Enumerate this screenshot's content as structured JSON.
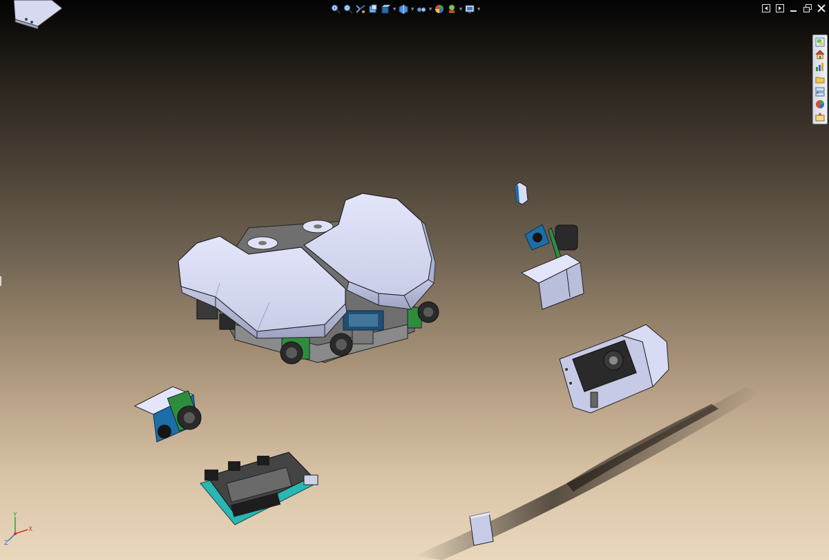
{
  "toolbar": {
    "icons": [
      "zoom-in-icon",
      "zoom-out-icon",
      "fly-icon",
      "view-cube-icon",
      "normal-view-icon",
      "iso-view-icon",
      "hide-show-icon",
      "render-style-icon",
      "lighting-icon",
      "display-options-icon"
    ]
  },
  "window_controls": {
    "icons": [
      "previous-window-icon",
      "next-window-icon",
      "minimize-icon",
      "restore-icon",
      "close-icon"
    ]
  },
  "side_toolbar": {
    "icons": [
      "tree-icon",
      "home-icon",
      "statistics-icon",
      "open-icon",
      "transfer-icon",
      "color-icon",
      "export-icon"
    ]
  },
  "axis": {
    "x": "X",
    "y": "Y",
    "z": "Z"
  },
  "colors": {
    "part_light": "#d5d9f1",
    "part_shadow": "#9da3c2",
    "pcb_green": "#2e8d3c",
    "pcb_blue": "#1c6ea8",
    "pcb_cyan": "#2bb6b2",
    "dark": "#2a2a2a"
  }
}
